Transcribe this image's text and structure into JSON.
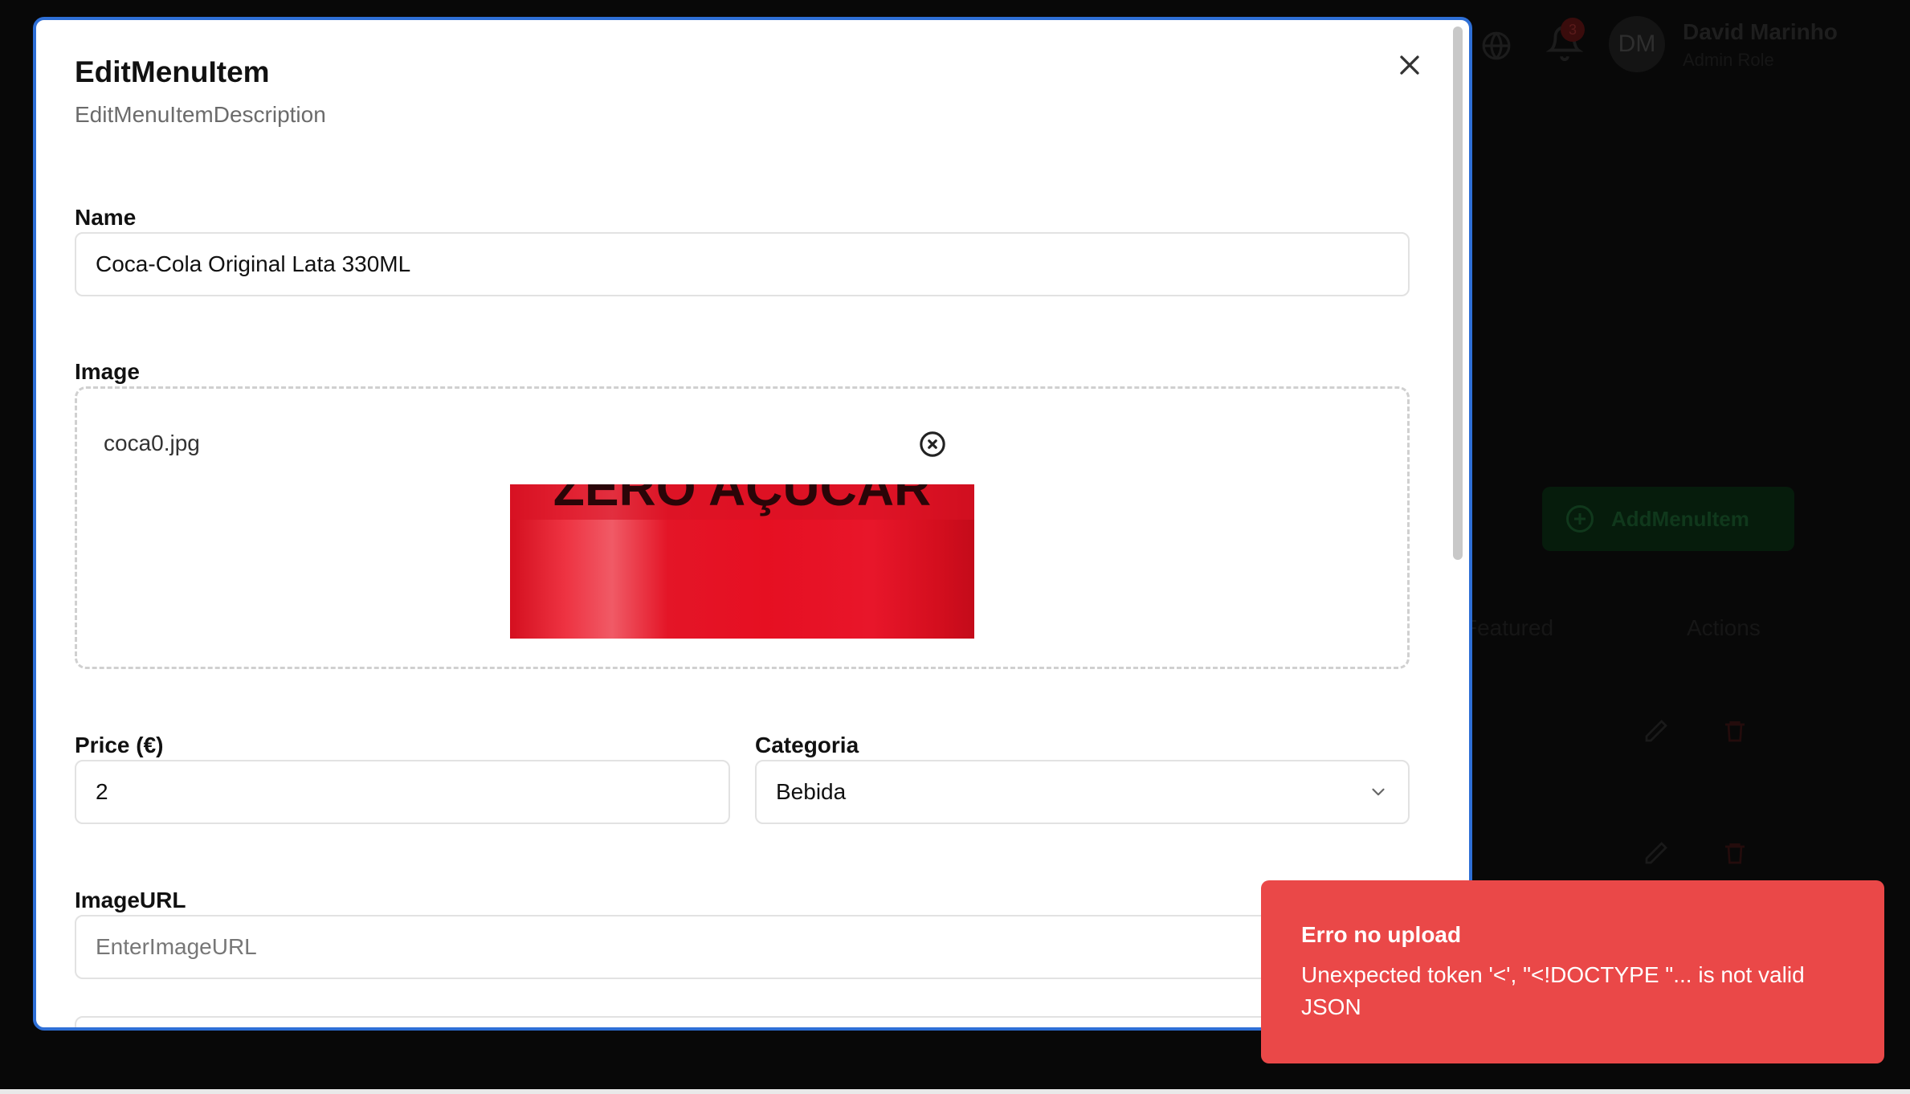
{
  "background": {
    "user": {
      "initials": "DM",
      "name": "David Marinho",
      "role": "Admin Role"
    },
    "notifications_count": "3",
    "add_button_label": "AddMenuItem",
    "table_headers": {
      "featured": "Featured",
      "actions": "Actions"
    },
    "icons": [
      "globe-icon",
      "bell-icon",
      "pencil-icon",
      "trash-icon",
      "plus-circle-icon"
    ]
  },
  "modal": {
    "title": "EditMenuItem",
    "description": "EditMenuItemDescription",
    "close_icon": "close-icon",
    "fields": {
      "name": {
        "label": "Name",
        "value": "Coca-Cola Original Lata 330ML"
      },
      "image": {
        "label": "Image",
        "file_name": "coca0.jpg",
        "remove_icon": "x-circle-icon",
        "preview_text": "ZERO AÇÚCAR"
      },
      "price": {
        "label": "Price (€)",
        "value": "2"
      },
      "category": {
        "label": "Categoria",
        "value": "Bebida",
        "icon": "chevron-down-icon"
      },
      "image_url": {
        "label": "ImageURL",
        "placeholder": "EnterImageURL",
        "value": ""
      }
    }
  },
  "toast": {
    "title": "Erro no upload",
    "message": "Unexpected token '<', \"<!DOCTYPE \"... is not valid JSON",
    "color": "#ea4848"
  },
  "colors": {
    "modal_border": "#2e6fd6",
    "overlay": "#040404"
  }
}
